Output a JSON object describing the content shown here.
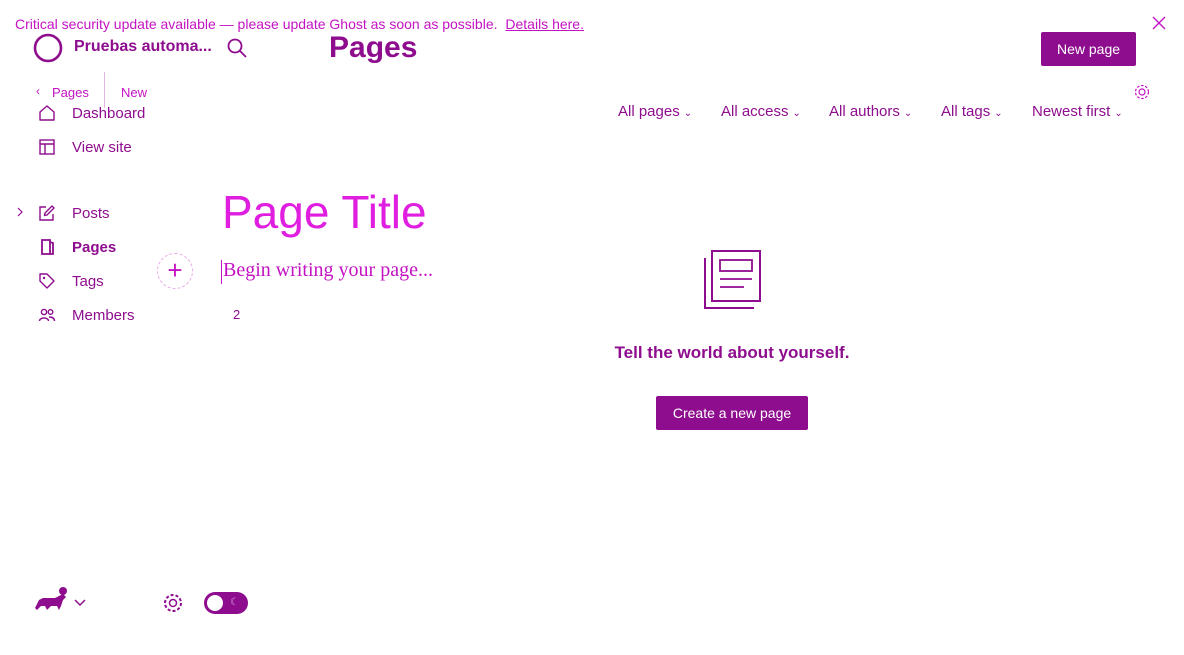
{
  "banner": {
    "text": "Critical security update available — please update Ghost as soon as possible.",
    "link": "Details here."
  },
  "site": {
    "name": "Pruebas automa..."
  },
  "header": {
    "title": "Pages",
    "new_button": "New page"
  },
  "breadcrumb": {
    "back": "‹",
    "parent": "Pages",
    "current": "New"
  },
  "sidebar": {
    "items": [
      {
        "label": "Dashboard",
        "icon": "home-icon"
      },
      {
        "label": "View site",
        "icon": "layout-icon"
      },
      {
        "label": "Posts",
        "icon": "pencil-square-icon"
      },
      {
        "label": "Pages",
        "icon": "page-icon"
      },
      {
        "label": "Tags",
        "icon": "tag-icon"
      },
      {
        "label": "Members",
        "icon": "members-icon"
      }
    ]
  },
  "filters": {
    "type": "All pages",
    "access": "All access",
    "authors": "All authors",
    "tags": "All tags",
    "sort": "Newest first"
  },
  "editor": {
    "title": "Page Title",
    "placeholder": "Begin writing your page...",
    "plus": "+",
    "count": "2"
  },
  "empty_state": {
    "text": "Tell the world about yourself.",
    "button": "Create a new page"
  },
  "colors": {
    "accent": "#8e0d8e",
    "accent_light": "#c313c3",
    "editor_title": "#e01ee0",
    "background": "#ffffff"
  }
}
